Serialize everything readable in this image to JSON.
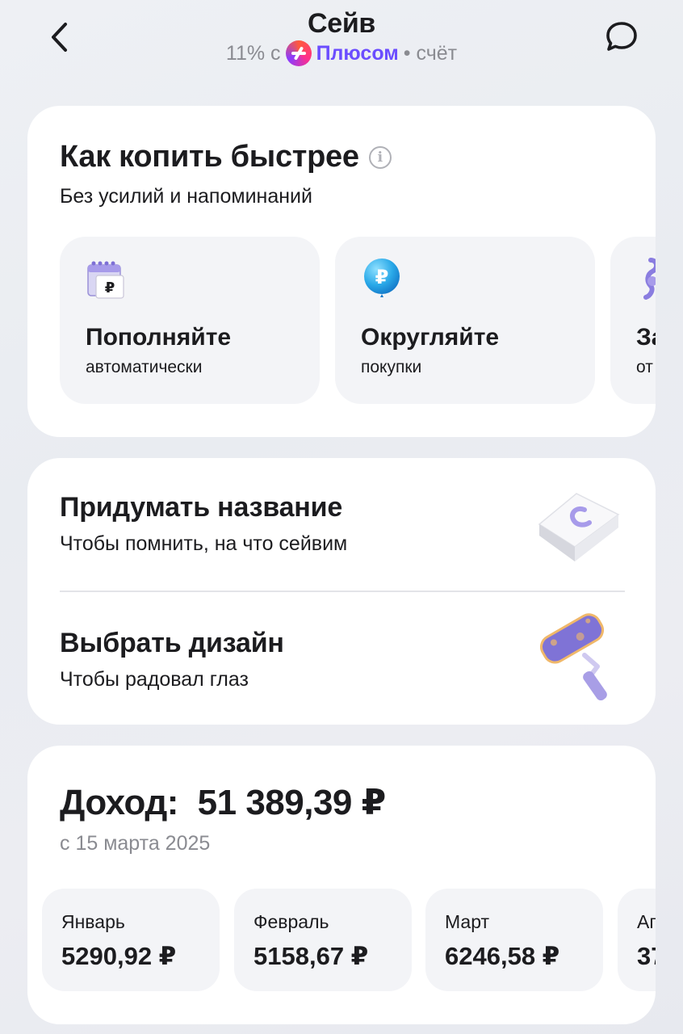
{
  "header": {
    "title": "Сейв",
    "rate_prefix": "11% с",
    "plus_label": "Плюсом",
    "rate_suffix": "• счёт"
  },
  "save_faster": {
    "title": "Как копить быстрее",
    "subtitle": "Без усилий и напоминаний",
    "tiles": [
      {
        "title": "Пополняйте",
        "subtitle": "автоматически",
        "icon": "calendar-ruble-icon"
      },
      {
        "title": "Округляйте",
        "subtitle": "покупки",
        "icon": "ruble-balloon-icon"
      },
      {
        "title": "За",
        "subtitle": "от",
        "icon": "ribbon-icon"
      }
    ]
  },
  "customize": {
    "items": [
      {
        "title": "Придумать название",
        "subtitle": "Чтобы помнить, на что сейвим",
        "icon": "keyboard-key-icon"
      },
      {
        "title": "Выбрать дизайн",
        "subtitle": "Чтобы радовал глаз",
        "icon": "paint-roller-icon"
      }
    ]
  },
  "income": {
    "label": "Доход:",
    "amount": "51 389,39 ₽",
    "since": "с 15 марта 2025",
    "months": [
      {
        "name": "Январь",
        "value": "5290,92 ₽"
      },
      {
        "name": "Февраль",
        "value": "5158,67 ₽"
      },
      {
        "name": "Март",
        "value": "6246,58 ₽"
      },
      {
        "name": "Ап",
        "value": "37"
      }
    ]
  },
  "colors": {
    "plus_accent": "#6b4dff",
    "card_bg": "#ffffff",
    "tile_bg": "#f3f4f7",
    "muted_text": "#8a8b91"
  }
}
